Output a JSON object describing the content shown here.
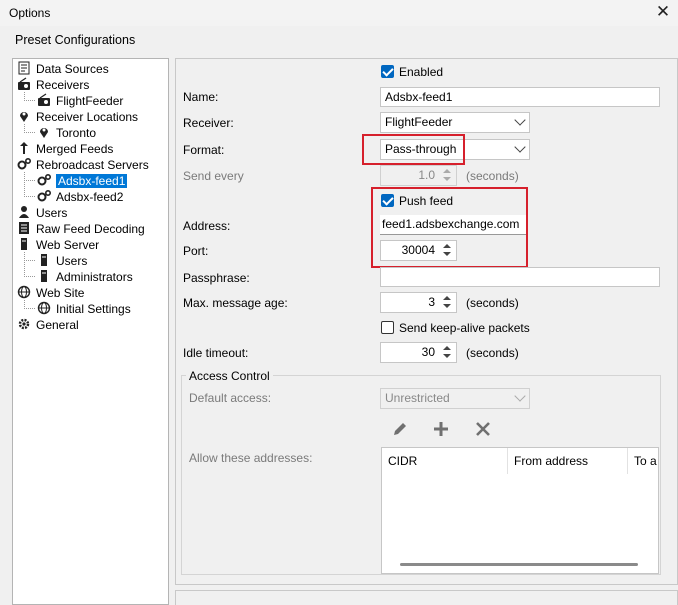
{
  "window": {
    "title": "Options"
  },
  "preset_label": "Preset Configurations",
  "tree": [
    {
      "label": "Data Sources",
      "icon": "document-icon"
    },
    {
      "label": "Receivers",
      "icon": "radio-icon"
    },
    {
      "label": "FlightFeeder",
      "icon": "radio-icon"
    },
    {
      "label": "Receiver Locations",
      "icon": "location-pin-icon"
    },
    {
      "label": "Toronto",
      "icon": "location-pin-icon"
    },
    {
      "label": "Merged Feeds",
      "icon": "merge-arrows-icon"
    },
    {
      "label": "Rebroadcast Servers",
      "icon": "gears-icon"
    },
    {
      "label": "Adsbx-feed1",
      "icon": "gears-icon",
      "selected": true
    },
    {
      "label": "Adsbx-feed2",
      "icon": "gears-icon"
    },
    {
      "label": "Users",
      "icon": "user-icon"
    },
    {
      "label": "Raw Feed Decoding",
      "icon": "document-lines-icon"
    },
    {
      "label": "Web Server",
      "icon": "server-icon"
    },
    {
      "label": "Users",
      "icon": "server-icon"
    },
    {
      "label": "Administrators",
      "icon": "server-icon"
    },
    {
      "label": "Web Site",
      "icon": "globe-icon"
    },
    {
      "label": "Initial Settings",
      "icon": "globe-icon"
    },
    {
      "label": "General",
      "icon": "gear-icon"
    }
  ],
  "form": {
    "enabled_label": "Enabled",
    "enabled": true,
    "name_label": "Name:",
    "name_value": "Adsbx-feed1",
    "receiver_label": "Receiver:",
    "receiver_value": "FlightFeeder",
    "format_label": "Format:",
    "format_value": "Pass-through",
    "send_every_label": "Send every",
    "send_every_value": "1.0",
    "seconds_unit": "(seconds)",
    "push_feed_label": "Push feed",
    "push_feed": true,
    "address_label": "Address:",
    "address_value": "feed1.adsbexchange.com",
    "port_label": "Port:",
    "port_value": "30004",
    "passphrase_label": "Passphrase:",
    "passphrase_value": "",
    "max_age_label": "Max. message age:",
    "max_age_value": "3",
    "keepalive_label": "Send keep-alive packets",
    "keepalive": false,
    "idle_label": "Idle timeout:",
    "idle_value": "30"
  },
  "access": {
    "group_label": "Access Control",
    "default_label": "Default access:",
    "default_value": "Unrestricted",
    "allow_label": "Allow these addresses:",
    "tools": [
      "pencil-icon",
      "plus-icon",
      "x-icon"
    ],
    "columns": [
      "CIDR",
      "From address",
      "To a"
    ]
  },
  "colors": {
    "accent": "#0078d7",
    "highlight_box": "#d6202c"
  }
}
